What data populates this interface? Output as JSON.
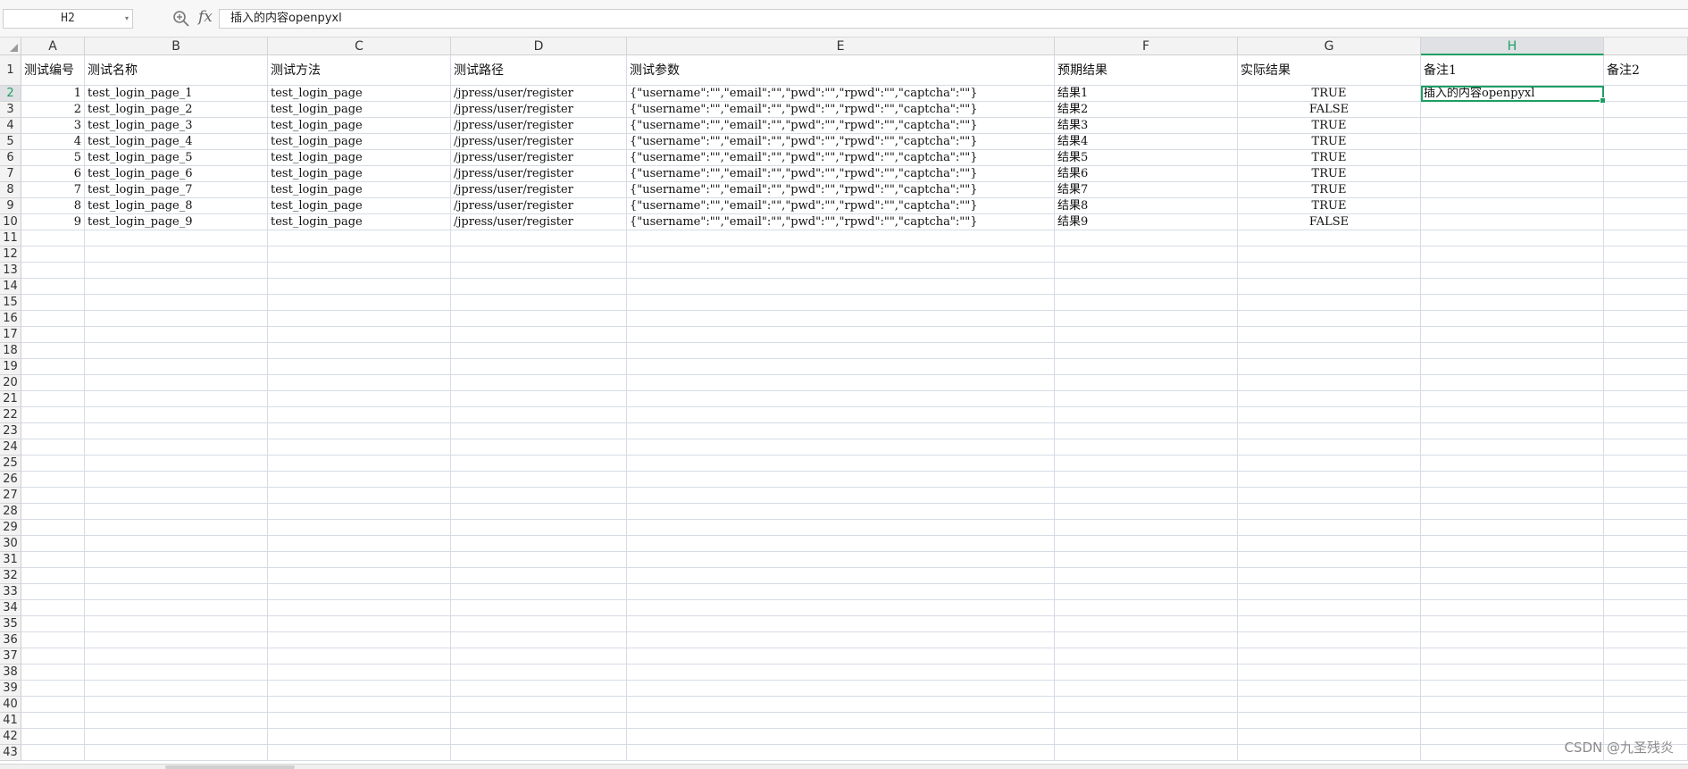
{
  "formula_bar": {
    "name_box": "H2",
    "fx_label": "fx",
    "formula_value": "插入的内容openpyxl"
  },
  "sheet": {
    "columns": [
      "A",
      "B",
      "C",
      "D",
      "E",
      "F",
      "G",
      "H"
    ],
    "active_column": "H",
    "active_row": 2,
    "row_count": 43,
    "header_row": [
      "测试编号",
      "测试名称",
      "测试方法",
      "测试路径",
      "测试参数",
      "预期结果",
      "实际结果",
      "备注1",
      "备注2"
    ],
    "rows": [
      [
        "1",
        "test_login_page_1",
        "test_login_page",
        "/jpress/user/register",
        "{\"username\":\"\",\"email\":\"\",\"pwd\":\"\",\"rpwd\":\"\",\"captcha\":\"\"}",
        "结果1",
        "TRUE",
        "插入的内容openpyxl"
      ],
      [
        "2",
        "test_login_page_2",
        "test_login_page",
        "/jpress/user/register",
        "{\"username\":\"\",\"email\":\"\",\"pwd\":\"\",\"rpwd\":\"\",\"captcha\":\"\"}",
        "结果2",
        "FALSE",
        ""
      ],
      [
        "3",
        "test_login_page_3",
        "test_login_page",
        "/jpress/user/register",
        "{\"username\":\"\",\"email\":\"\",\"pwd\":\"\",\"rpwd\":\"\",\"captcha\":\"\"}",
        "结果3",
        "TRUE",
        ""
      ],
      [
        "4",
        "test_login_page_4",
        "test_login_page",
        "/jpress/user/register",
        "{\"username\":\"\",\"email\":\"\",\"pwd\":\"\",\"rpwd\":\"\",\"captcha\":\"\"}",
        "结果4",
        "TRUE",
        ""
      ],
      [
        "5",
        "test_login_page_5",
        "test_login_page",
        "/jpress/user/register",
        "{\"username\":\"\",\"email\":\"\",\"pwd\":\"\",\"rpwd\":\"\",\"captcha\":\"\"}",
        "结果5",
        "TRUE",
        ""
      ],
      [
        "6",
        "test_login_page_6",
        "test_login_page",
        "/jpress/user/register",
        "{\"username\":\"\",\"email\":\"\",\"pwd\":\"\",\"rpwd\":\"\",\"captcha\":\"\"}",
        "结果6",
        "TRUE",
        ""
      ],
      [
        "7",
        "test_login_page_7",
        "test_login_page",
        "/jpress/user/register",
        "{\"username\":\"\",\"email\":\"\",\"pwd\":\"\",\"rpwd\":\"\",\"captcha\":\"\"}",
        "结果7",
        "TRUE",
        ""
      ],
      [
        "8",
        "test_login_page_8",
        "test_login_page",
        "/jpress/user/register",
        "{\"username\":\"\",\"email\":\"\",\"pwd\":\"\",\"rpwd\":\"\",\"captcha\":\"\"}",
        "结果8",
        "TRUE",
        ""
      ],
      [
        "9",
        "test_login_page_9",
        "test_login_page",
        "/jpress/user/register",
        "{\"username\":\"\",\"email\":\"\",\"pwd\":\"\",\"rpwd\":\"\",\"captcha\":\"\"}",
        "结果9",
        "FALSE",
        ""
      ]
    ]
  },
  "colors": {
    "selection": "#1e9e63",
    "gridline": "#d6dbe6",
    "header_bg": "#f3f3f3"
  },
  "watermark": "CSDN @九圣残炎"
}
